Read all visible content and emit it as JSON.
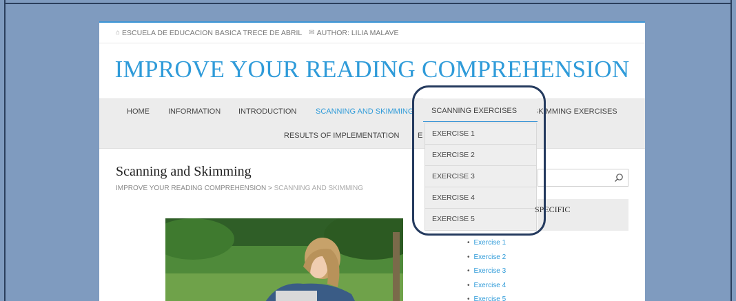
{
  "topbar": {
    "school": "ESCUELA DE EDUCACION BASICA TRECE DE ABRIL",
    "author": "AUTHOR: LILIA MALAVE"
  },
  "site_title": "IMPROVE YOUR READING COMPREHENSION",
  "nav": {
    "row1": [
      "HOME",
      "INFORMATION",
      "INTRODUCTION",
      "SCANNING AND SKIMMING",
      "SCANNING EXERCISES",
      "SKIMMING EXERCISES"
    ],
    "row2": [
      "RESULTS OF IMPLEMENTATION",
      "E"
    ]
  },
  "dropdown": [
    "EXERCISE 1",
    "EXERCISE 2",
    "EXERCISE 3",
    "EXERCISE 4",
    "EXERCISE 5"
  ],
  "post": {
    "title": "Scanning and Skimming",
    "breadcrumb_home": "IMPROVE YOUR READING COMPREHENSION",
    "breadcrumb_sep": ">",
    "breadcrumb_current": "SCANNING AND SKIMMING"
  },
  "sidebar": {
    "widget_title": "SPECIFIC",
    "links": [
      "Exercise 1",
      "Exercise 2",
      "Exercise 3",
      "Exercise 4",
      "Exercise 5"
    ]
  },
  "colors": {
    "accent": "#2f9bd9",
    "background": "#7f9bbf",
    "highlight_border": "#243a5e"
  },
  "icons": {
    "home": "home-icon",
    "author": "envelope-icon",
    "search": "search-icon"
  }
}
